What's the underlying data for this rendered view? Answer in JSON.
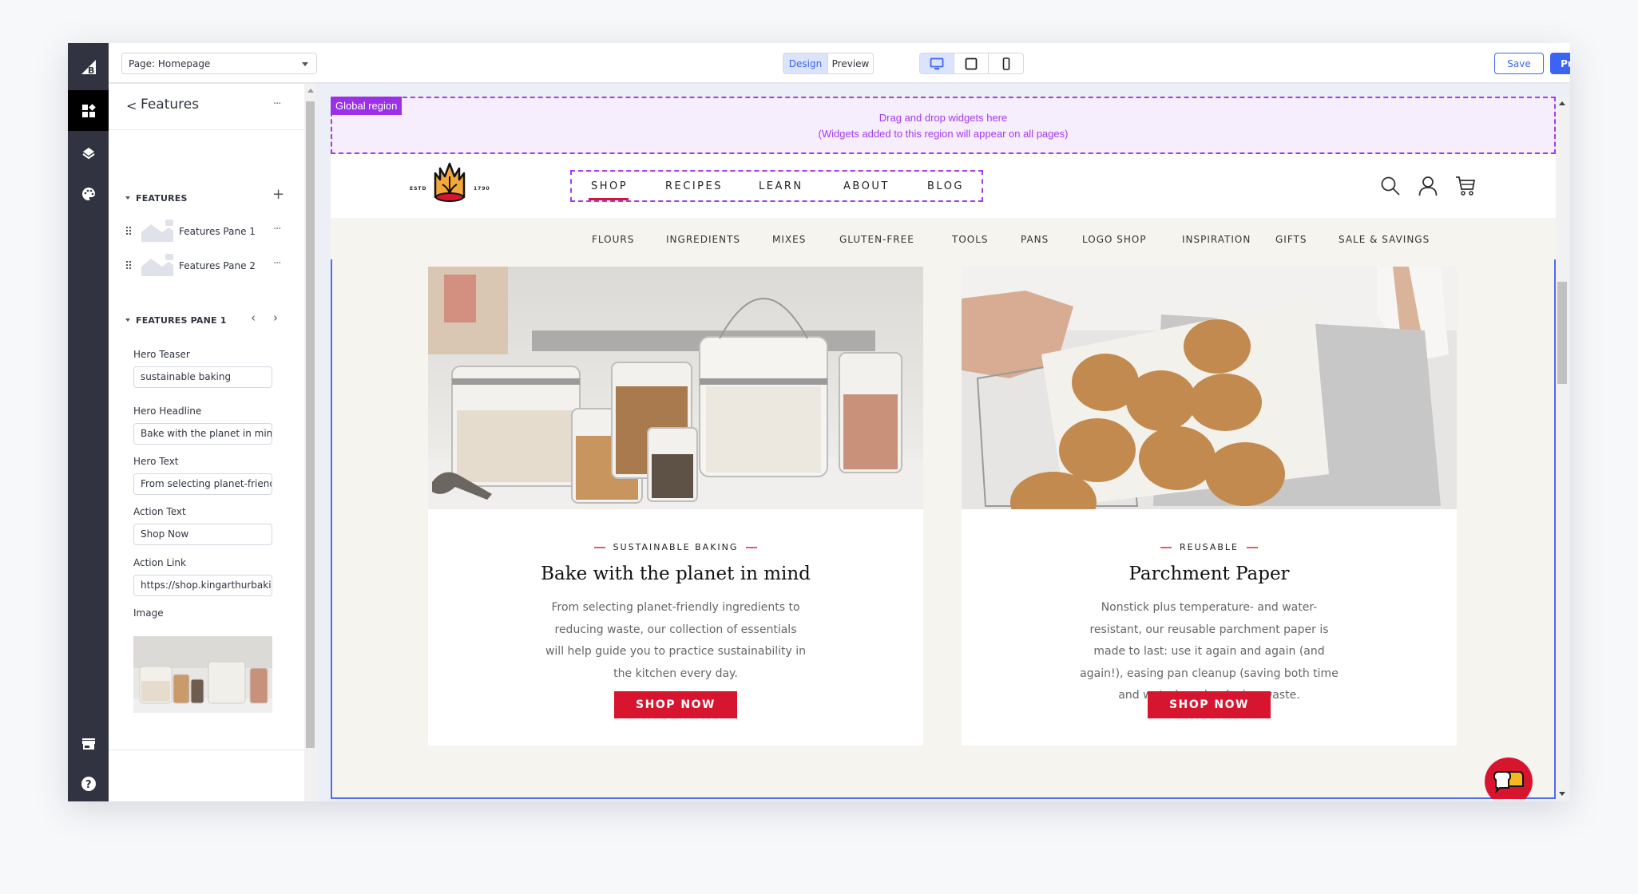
{
  "topbar": {
    "page_select": "Page: Homepage",
    "mode_tabs": [
      {
        "label": "Design",
        "active": true
      },
      {
        "label": "Preview",
        "active": false
      }
    ],
    "devices": [
      {
        "icon": "desktop-icon",
        "active": true
      },
      {
        "icon": "tablet-icon",
        "active": false
      },
      {
        "icon": "mobile-icon",
        "active": false
      }
    ],
    "save_label": "Save",
    "publish_label": "Publish"
  },
  "rail": {
    "items": [
      "bigcommerce-logo",
      "widgets-icon",
      "layers-icon",
      "theme-palette-icon",
      "storefront-icon",
      "help-icon"
    ],
    "active": "widgets-icon"
  },
  "panel": {
    "back_label": "<",
    "title": "Features",
    "more": "···",
    "features_section": "FEATURES",
    "add": "+",
    "panes": [
      {
        "label": "Features Pane 1"
      },
      {
        "label": "Features Pane 2"
      }
    ],
    "pane_section": "FEATURES PANE 1",
    "prev": "‹",
    "next": "›",
    "fields": {
      "hero_teaser_label": "Hero Teaser",
      "hero_teaser_value": "sustainable baking",
      "hero_headline_label": "Hero Headline",
      "hero_headline_value": "Bake with the planet in mind",
      "hero_text_label": "Hero Text",
      "hero_text_value": "From selecting planet-friendly ingredients to reducing waste",
      "action_text_label": "Action Text",
      "action_text_value": "Shop Now",
      "action_link_label": "Action Link",
      "action_link_value": "https://shop.kingarthurbaking.com",
      "image_label": "Image"
    }
  },
  "canvas": {
    "global_region": {
      "tag": "Global region",
      "line1": "Drag and drop widgets here",
      "line2": "(Widgets added to this region will appear on all pages)"
    },
    "logo": {
      "left": "ESTD",
      "right": "1790"
    },
    "main_nav": [
      {
        "label": "SHOP",
        "active": true
      },
      {
        "label": "RECIPES",
        "active": false
      },
      {
        "label": "LEARN",
        "active": false
      },
      {
        "label": "ABOUT",
        "active": false
      },
      {
        "label": "BLOG",
        "active": false
      }
    ],
    "header_icons": [
      "search-icon",
      "account-icon",
      "cart-icon"
    ],
    "sub_nav": [
      "FLOURS",
      "INGREDIENTS",
      "MIXES",
      "GLUTEN-FREE",
      "TOOLS",
      "PANS",
      "LOGO SHOP",
      "INSPIRATION",
      "GIFTS",
      "SALE & SAVINGS"
    ],
    "cards": [
      {
        "teaser": "SUSTAINABLE BAKING",
        "headline": "Bake with the planet in mind",
        "body": "From selecting planet-friendly ingredients to reducing waste, our collection of essentials will help guide you to practice sustainability in the kitchen every day.",
        "button": "SHOP NOW"
      },
      {
        "teaser": "REUSABLE",
        "headline": "Parchment Paper",
        "body": "Nonstick plus temperature- and water-resistant, our reusable parchment paper is made to last: use it again and again (and again!), easing pan cleanup (saving both time and water), and reducing waste.",
        "button": "SHOP NOW"
      }
    ],
    "colors": {
      "accent": "#3c64f4",
      "region": "#a33bef",
      "brand_red": "#d8152f"
    }
  }
}
